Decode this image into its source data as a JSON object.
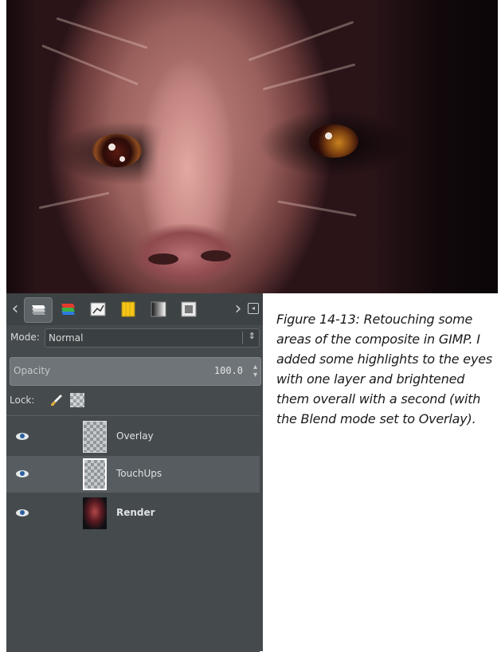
{
  "caption": {
    "figure": "Figure 14-13: Retouching some areas of the composite in GIMP. I added some highlights to the eyes with one layer and brightened them overall with a second (with the Blend mode set to Overlay)."
  },
  "image": {
    "subject": "render-closeup-face"
  },
  "layers_panel": {
    "tabs": [
      "layers-icon",
      "channels-icon",
      "paths-icon",
      "colormap-icon",
      "histogram-icon",
      "selection-editor-icon"
    ],
    "mode_label": "Mode:",
    "mode_value": "Normal",
    "opacity_label": "Opacity",
    "opacity_value": "100.0",
    "lock_label": "Lock:",
    "layers": [
      {
        "name": "Overlay",
        "visible": true,
        "selected": false
      },
      {
        "name": "TouchUps",
        "visible": true,
        "selected": true
      },
      {
        "name": "Render",
        "visible": true,
        "selected": false
      }
    ]
  },
  "colors": {
    "panel_bg": "#454a4d",
    "selected_row": "#565c5f",
    "caption_text": "#1a1a1a"
  }
}
